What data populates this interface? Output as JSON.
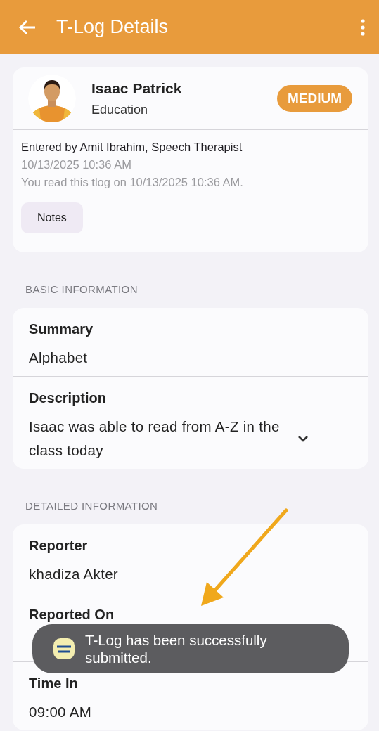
{
  "app_bar": {
    "title": "T-Log Details"
  },
  "header_card": {
    "name": "Isaac Patrick",
    "program": "Education",
    "priority": "MEDIUM",
    "entered_by": "Entered by Amit Ibrahim, Speech Therapist",
    "entered_on": "10/13/2025 10:36 AM",
    "read_note": "You read this tlog on 10/13/2025 10:36 AM.",
    "notes_button": "Notes"
  },
  "sections": [
    {
      "title": "BASIC INFORMATION",
      "fields": [
        {
          "label": "Summary",
          "value": "Alphabet",
          "kind": "plain"
        },
        {
          "label": "Description",
          "value": "Isaac was able to read from A-Z in the class today",
          "kind": "expandable",
          "expanded": false
        }
      ]
    },
    {
      "title": "DETAILED INFORMATION",
      "fields": [
        {
          "label": "Reporter",
          "value": "khadiza Akter",
          "kind": "plain"
        },
        {
          "label": "Reported On",
          "kind": "plain"
        },
        {
          "label": "Time In",
          "value": "09:00 AM",
          "kind": "plain"
        }
      ]
    }
  ],
  "toast": {
    "message": "T-Log has been successfully submitted."
  }
}
